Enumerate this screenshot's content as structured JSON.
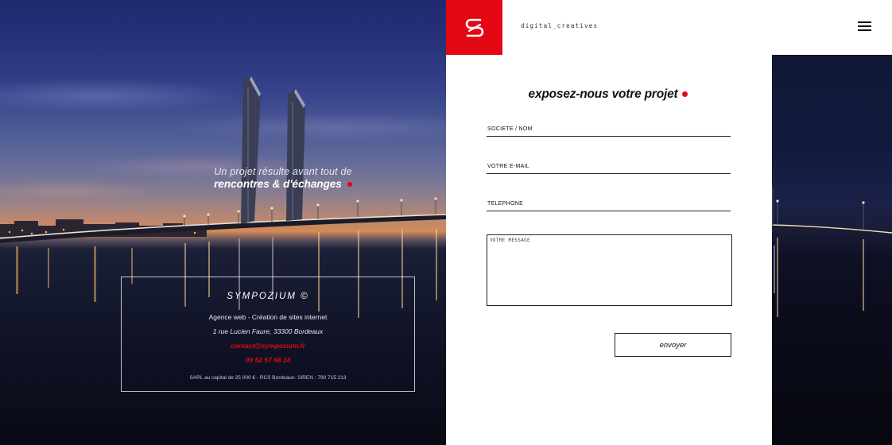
{
  "hero": {
    "tagline_line1": "Un projet résulte avant tout de",
    "tagline_line2": "rencontres & d'échanges"
  },
  "company": {
    "name": "SYMPOZIUM ©",
    "description": "Agence web - Création de sites internet",
    "address": "1 rue Lucien Faure, 33300 Bordeaux",
    "email": "contact@sympozium.fr",
    "phone": "09 52 57 68 14",
    "legal": "SARL au capital de 25 000 € - RCS Bordeaux- SIREN : 790 715 213"
  },
  "header": {
    "logo_letter": "S",
    "tagline": "digital_creatives",
    "menu_icon": "hamburger-menu-icon"
  },
  "form": {
    "title": "exposez-nous votre projet",
    "fields": {
      "company": "SOCIETE / NOM",
      "email": "VOTRE E-MAIL",
      "phone": "TELEPHONE",
      "message": "VOTRE MESSAGE"
    },
    "submit_label": "envoyer"
  },
  "colors": {
    "accent": "#e30613",
    "text": "#111111",
    "background": "#ffffff"
  }
}
